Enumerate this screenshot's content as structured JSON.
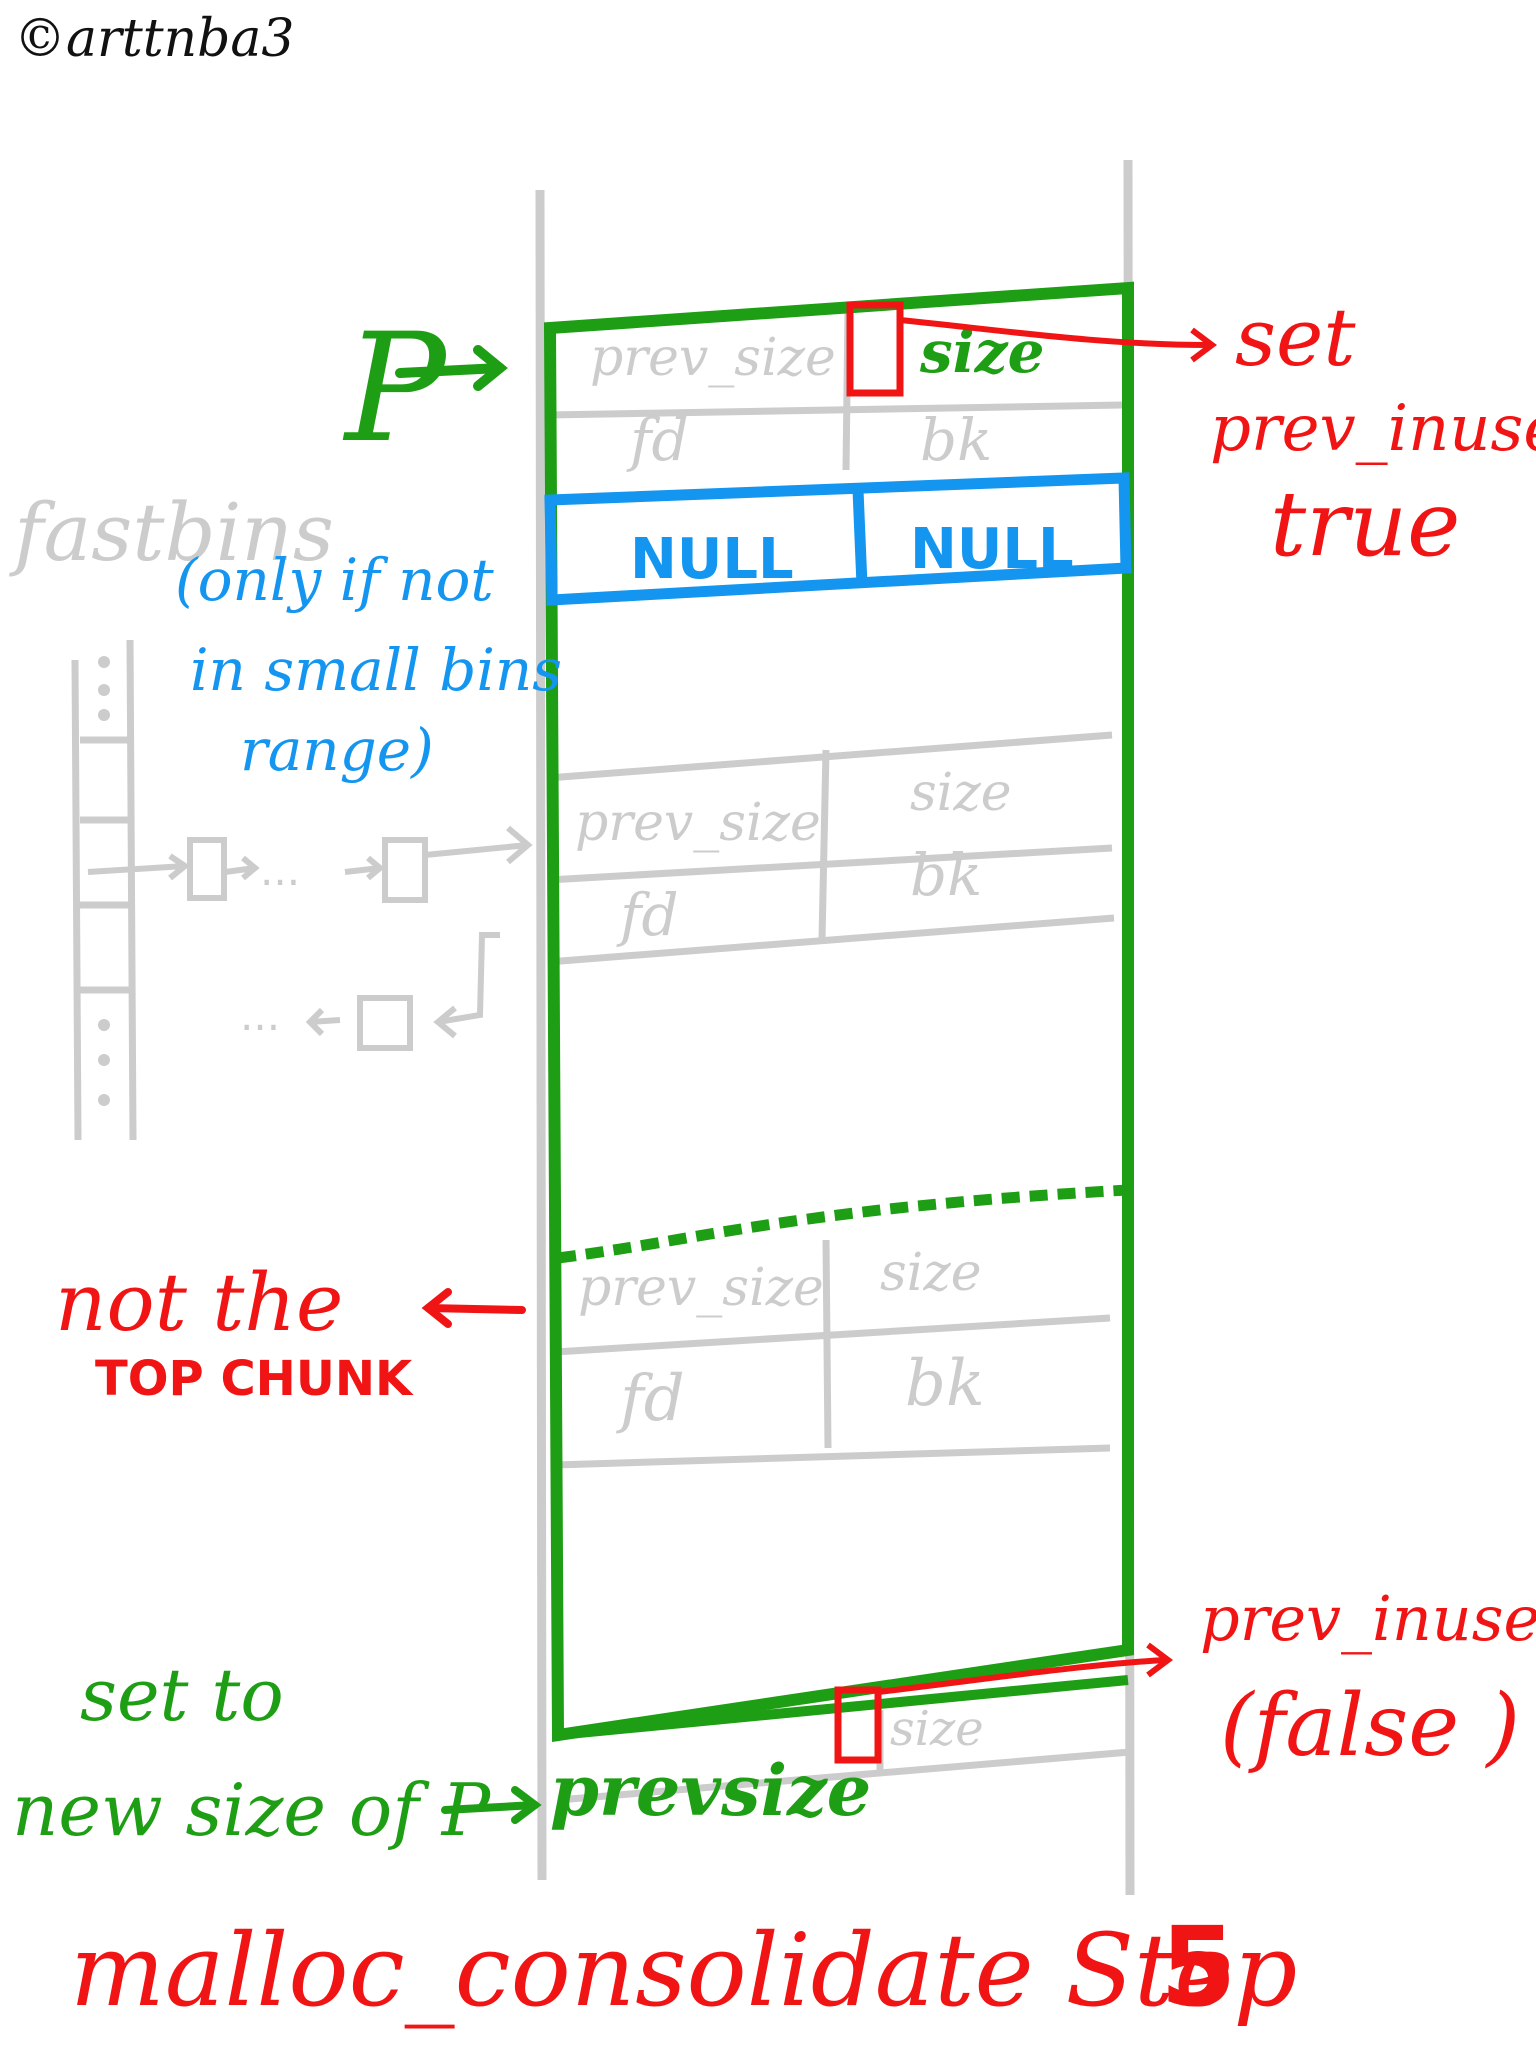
{
  "copyright": "©arttnba3",
  "colors": {
    "green": "#1e9e14",
    "red": "#f01414",
    "blue": "#1496f0",
    "gray": "#cccccc",
    "black": "#111111"
  },
  "chunk_top": {
    "prev_size": "prev_size",
    "size": "size",
    "fd": "fd",
    "bk": "bk",
    "fd_value": "NULL",
    "bk_value": "NULL"
  },
  "chunk_mid": {
    "prev_size": "prev_size",
    "size": "size",
    "fd": "fd",
    "bk": "bk"
  },
  "chunk_low": {
    "prev_size": "prev_size",
    "size": "size",
    "fd": "fd",
    "bk": "bk"
  },
  "chunk_next": {
    "prev_size": "prevsize",
    "size": "size"
  },
  "labels": {
    "p": "P",
    "set": "set",
    "prev_inuse": "prev_inuse",
    "true": "true",
    "fastbins": "fastbins",
    "note_line1": "(only if not",
    "note_line2": "in small bins",
    "note_line3": "range)",
    "dots": "...",
    "not_top_1": "not the",
    "not_top_2": "TOP CHUNK",
    "set_to_1": "set to",
    "set_to_2": "new size of P",
    "prev_inuse_q": "prev_inuse?",
    "false": "(false )"
  },
  "caption": {
    "text": "malloc_consolidate Step",
    "step": "5"
  }
}
